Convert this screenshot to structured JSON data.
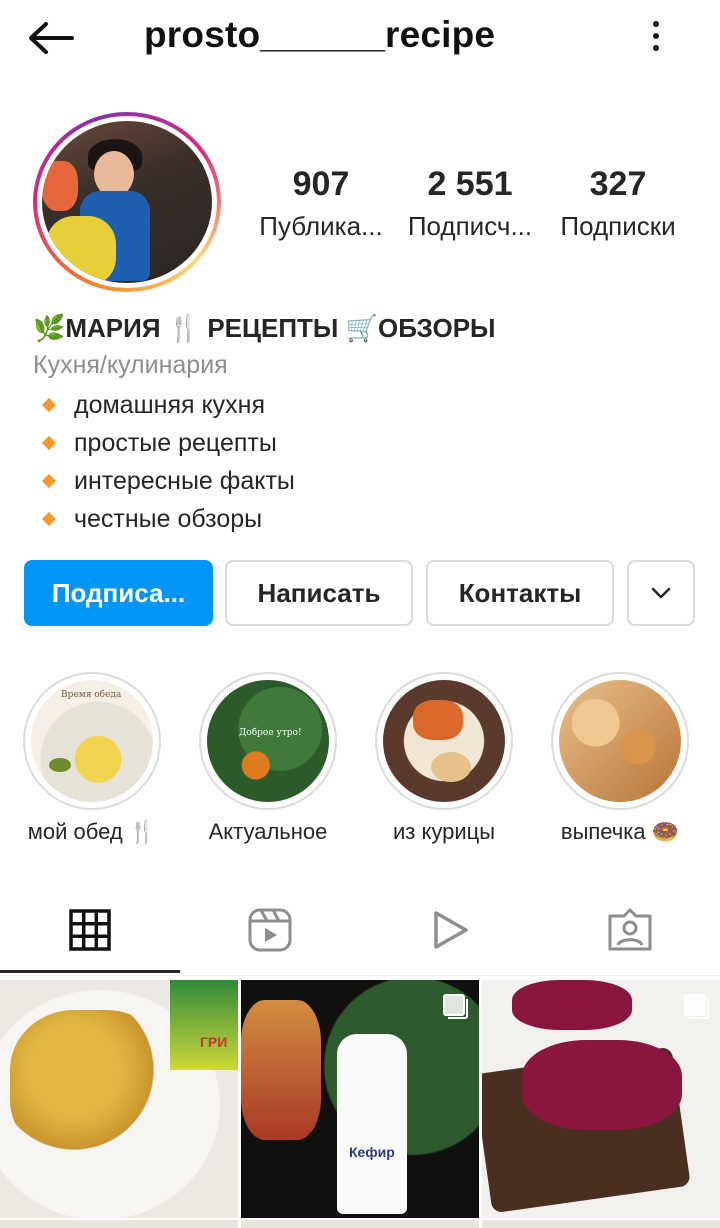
{
  "header": {
    "username": "prosto______recipe",
    "back_icon": "arrow-left-icon",
    "more_icon": "more-vertical-icon"
  },
  "stats": {
    "posts": {
      "value": "907",
      "label": "Публика..."
    },
    "followers": {
      "value": "2 551",
      "label": "Подписч..."
    },
    "following": {
      "value": "327",
      "label": "Подписки"
    }
  },
  "bio": {
    "name": "🌿МАРИЯ 🍴 РЕЦЕПТЫ 🛒ОБЗОРЫ",
    "category": "Кухня/кулинария",
    "items": [
      "домашняя кухня",
      "простые рецепты",
      "интересные факты",
      "честные обзоры"
    ]
  },
  "buttons": {
    "follow": "Подписа...",
    "message": "Написать",
    "contacts": "Контакты",
    "more_icon": "chevron-down-icon"
  },
  "highlights": [
    {
      "label": "мой обед 🍴",
      "image_text": "Время обеда"
    },
    {
      "label": "Актуальное",
      "image_text": "Доброе утро!"
    },
    {
      "label": "из курицы"
    },
    {
      "label": "выпечка 🍩"
    }
  ],
  "tabs": [
    {
      "icon": "grid-icon",
      "active": true
    },
    {
      "icon": "reels-icon",
      "active": false
    },
    {
      "icon": "video-play-icon",
      "active": false
    },
    {
      "icon": "tagged-icon",
      "active": false
    }
  ],
  "posts": [
    {
      "image_text": "ГРИ"
    },
    {
      "image_text": "Кефир",
      "multi": true
    },
    {
      "multi": true
    }
  ],
  "colors": {
    "accent": "#0095f6",
    "text": "#262626",
    "secondary": "#8e8e8e",
    "border": "#dbdbdb"
  }
}
